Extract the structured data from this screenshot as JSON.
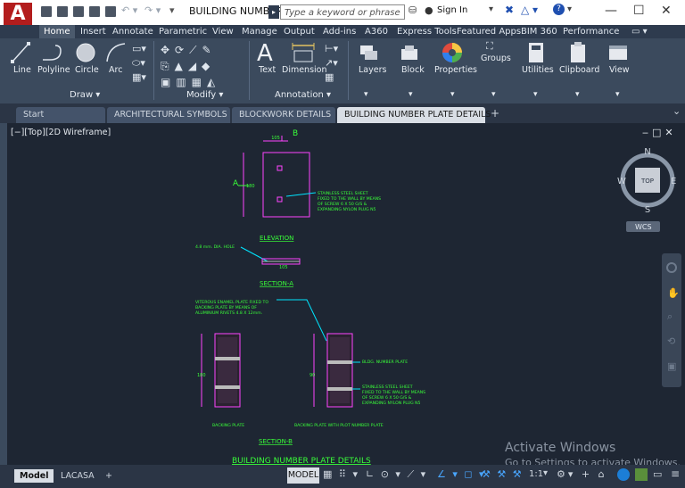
{
  "app": {
    "logo": "A",
    "title": "BUILDING NUMBER P...",
    "search_placeholder": "Type a keyword or phrase",
    "sign_in": "Sign In"
  },
  "ribbon_tabs": [
    "Home",
    "Insert",
    "Annotate",
    "Parametric",
    "View",
    "Manage",
    "Output",
    "Add-ins",
    "A360",
    "Express Tools",
    "Featured Apps",
    "BIM 360",
    "Performance"
  ],
  "ribbon": {
    "draw": {
      "line": "Line",
      "polyline": "Polyline",
      "circle": "Circle",
      "arc": "Arc",
      "group_label": "Draw"
    },
    "modify": {
      "group_label": "Modify"
    },
    "annotation": {
      "text": "Text",
      "dimension": "Dimension",
      "group_label": "Annotation"
    },
    "layers": "Layers",
    "block": "Block",
    "properties": "Properties",
    "groups": "Groups",
    "utilities": "Utilities",
    "clipboard": "Clipboard",
    "view": "View"
  },
  "doc_tabs": [
    "Start",
    "ARCHITECTURAL SYMBOLS",
    "BLOCKWORK DETAILS",
    "BUILDING NUMBER PLATE DETAILS"
  ],
  "viewport": {
    "label": "[−][Top][2D Wireframe]"
  },
  "viewcube": {
    "north": "N",
    "south": "S",
    "east": "E",
    "west": "W",
    "top": "TOP",
    "wcs": "WCS"
  },
  "drawing": {
    "label_b": "B",
    "label_a": "A",
    "dim_105": "105",
    "dim_180": "180",
    "dim_90": "90",
    "elev_note": [
      "STAINLESS STEEL SHEET",
      "FIXED TO THE WALL BY MEANS",
      "OF SCREW 6 X 50 G/S &",
      "EXPANDING NYLON PLUG N5"
    ],
    "elevation_title": "ELEVATION",
    "hole_note": "4.8 mm. DIA. HOLE",
    "section_a_title": "SECTION-A",
    "enamel_note": [
      "VITEROUS ENAMEL PLATE FIXED TO",
      "BACKING PLATE BY MEANS OF",
      "ALUMINIUM RIVETS 4.8 X 12mm."
    ],
    "number_plate_note": "BLDG. NUMBER PLATE",
    "steel_note": [
      "STAINLESS STEEL SHEET",
      "FIXED TO THE WALL BY MEANS",
      "OF SCREW 6 X 50 G/S &",
      "EXPANDING NYLON PLUG N5"
    ],
    "backing_plate": "BACKING PLATE",
    "backing_plate_with": "BACKING PLATE WITH PLOT NUMBER PLATE",
    "section_b_title": "SECTION-B",
    "main_title": "BUILDING NUMBER PLATE DETAILS"
  },
  "watermark": {
    "line1": "Activate Windows",
    "line2": "Go to Settings to activate Windows."
  },
  "layout_tabs": [
    "Model",
    "LACASA"
  ],
  "status": {
    "model": "MODEL",
    "scale": "1:1"
  }
}
